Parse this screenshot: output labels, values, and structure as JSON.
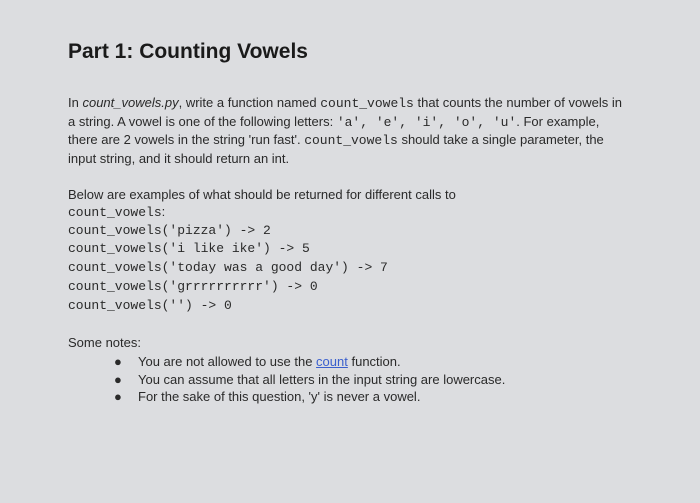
{
  "heading": "Part 1: Counting Vowels",
  "intro": {
    "pre_file": "In ",
    "file": "count_vowels.py",
    "post_file": ", write a function named ",
    "fn1": "count_vowels",
    "after_fn1": " that counts the number of vowels in a string. A vowel is one of the following letters: ",
    "letters": "'a', 'e', 'i', 'o', 'u'",
    "after_letters": ". For example, there are 2 vowels in the string 'run fast'. ",
    "fn2": "count_vowels",
    "after_fn2": " should take a single parameter, the input string, and it should return an int."
  },
  "examples_intro": {
    "line1": "Below are examples of what should be returned for different calls to",
    "fn": "count_vowels",
    "colon": ":"
  },
  "examples": [
    "count_vowels('pizza') -> 2",
    "count_vowels('i like ike') -> 5",
    "count_vowels('today was a good day') -> 7",
    "count_vowels('grrrrrrrrrr') -> 0",
    "count_vowels('') -> 0"
  ],
  "notes": {
    "intro": "Some notes:",
    "items": [
      {
        "pre": "You are not allowed to use the ",
        "link": "count",
        "post": " function."
      },
      {
        "pre": "You can assume that all letters in the input string are lowercase.",
        "link": "",
        "post": ""
      },
      {
        "pre": "For the sake of this question, 'y' is never a vowel.",
        "link": "",
        "post": ""
      }
    ]
  }
}
